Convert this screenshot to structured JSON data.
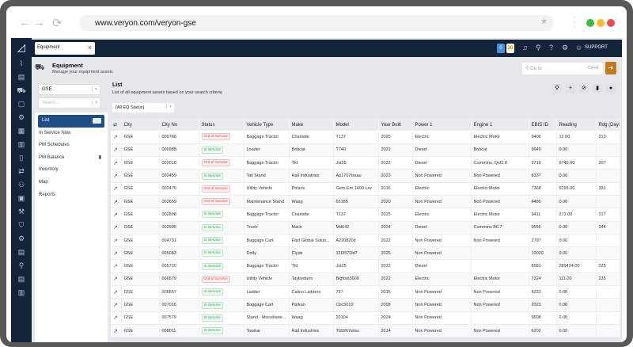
{
  "browser": {
    "url": "www.veryon.com/veryon-gse",
    "dots": [
      "#3dbb3d",
      "#f5b82e",
      "#ee4b4b"
    ]
  },
  "topbar": {
    "tab": "Equipment",
    "badge_blue": "0",
    "badge_yellow": "30",
    "support": "SUPPORT"
  },
  "header": {
    "title": "Equipment",
    "subtitle": "Manage your equipment assets",
    "goto_placeholder": "Go to",
    "goto_shortcut": "Ctrl+K"
  },
  "left": {
    "select1": "GSE",
    "select2_placeholder": "Select...",
    "menu": [
      "List",
      "In Service Now",
      "PM Schedules",
      "PM Balance",
      "Inventory",
      "Map",
      "Reports"
    ]
  },
  "list": {
    "title": "List",
    "subtitle": "List of all equipment assets based on your search criteria",
    "filter": "(All EQ Status)"
  },
  "colors": {
    "navy": "#13233a",
    "active": "#1f4e85",
    "accent": "#c07a1e",
    "out": "#d9534f",
    "in": "#3aa35c"
  },
  "table": {
    "columns": [
      "City",
      "City No",
      "Status",
      "Vehicle Type",
      "Make",
      "Model",
      "Year Built",
      "Power 1",
      "Engine 1",
      "EBIS ID",
      "Reading",
      "Rdg (Days)"
    ],
    "rows": [
      [
        "GSE",
        "000766",
        "Out of Service",
        "Baggage Tractor",
        "Charlatte",
        "T137",
        "2025",
        "Electric",
        "Electric Motor",
        "9406",
        "12.00",
        "213"
      ],
      [
        "GSE",
        "000985",
        "In Service",
        "Loader",
        "Bobcat",
        "T740",
        "2022",
        "Diesel",
        "Bobcat",
        "9649",
        "0.00",
        ""
      ],
      [
        "GSE",
        "002018",
        "Out of Service",
        "Baggage Tractor",
        "Tld",
        "Jst25",
        "2022",
        "Diesel",
        "Cummins, Qsf2.8",
        "9710",
        "6745.00",
        "207"
      ],
      [
        "GSE",
        "002459",
        "In Service",
        "Tail Stand",
        "Hall Industries",
        "Ap1707tssau",
        "2023",
        "Non Powered",
        "Non Powered",
        "8337",
        "0.00",
        ""
      ],
      [
        "GSE",
        "002476",
        "Out of Service",
        "Utility Vehicle",
        "Polaris",
        "Gem Em 1400 Lsv",
        "2016",
        "Electric",
        "Electric Motor",
        "7368",
        "9295.00",
        "331"
      ],
      [
        "GSE",
        "002659",
        "Out of Service",
        "Maintenance Stand",
        "Waag",
        "65185",
        "2020",
        "Non Powered",
        "Non Powered",
        "4486",
        "0.00",
        ""
      ],
      [
        "GSE",
        "002898",
        "In Service",
        "Baggage Tractor",
        "Charlatte",
        "T137",
        "2025",
        "Electric",
        "Electric Motor",
        "9411",
        "272.00",
        "217"
      ],
      [
        "GSE",
        "002905",
        "In Service",
        "Truck",
        "Mack",
        "Md642",
        "2024",
        "Diesel",
        "Cummins B6.7",
        "9556",
        "0.00",
        "244"
      ],
      [
        "GSE",
        "004731",
        "In Service",
        "Baggage Cart",
        "Fast Global Soluti...",
        "A220820d",
        "2022",
        "Non Powered",
        "Non Powered",
        "2797",
        "0.00",
        ""
      ],
      [
        "GSE",
        "005083",
        "In Service",
        "Dolly",
        "Clyde",
        "15f3570ld7",
        "2025",
        "Non Powered",
        "",
        "10009",
        "0.00",
        ""
      ],
      [
        "GSE",
        "005720",
        "In Service",
        "Baggage Tractor",
        "Tld",
        "Jst25",
        "2022",
        "Diesel",
        "",
        "8581",
        "289424.00",
        "225"
      ],
      [
        "GSE",
        "006579",
        "Out of Service",
        "Utility Vehicle",
        "Taylordunn",
        "Bigfoot3000",
        "2022",
        "Electric",
        "Electric Motor",
        "7324",
        "111.00",
        "235"
      ],
      [
        "GSE",
        "006657",
        "In Service",
        "Ladder",
        "Calico Ladders",
        "737",
        "2015",
        "Non Powered",
        "Non Powered",
        "4231",
        "0.00",
        ""
      ],
      [
        "GSE",
        "007016",
        "In Service",
        "Baggage Cart",
        "Parkan",
        "Cbc5010",
        "2008",
        "Non Powered",
        "Non Powered",
        "2023",
        "0.00",
        ""
      ],
      [
        "GSE",
        "007579",
        "In Service",
        "Stand - Miscellane...",
        "Waag",
        "20104",
        "2024",
        "Non Powered",
        "",
        "9608",
        "0.00",
        ""
      ],
      [
        "GSE",
        "008011",
        "In Service",
        "Towbar",
        "Hall Industries",
        "Tb9267wlss",
        "2014",
        "Non Powered",
        "Non Powered",
        "6202",
        "0.00",
        ""
      ]
    ]
  }
}
